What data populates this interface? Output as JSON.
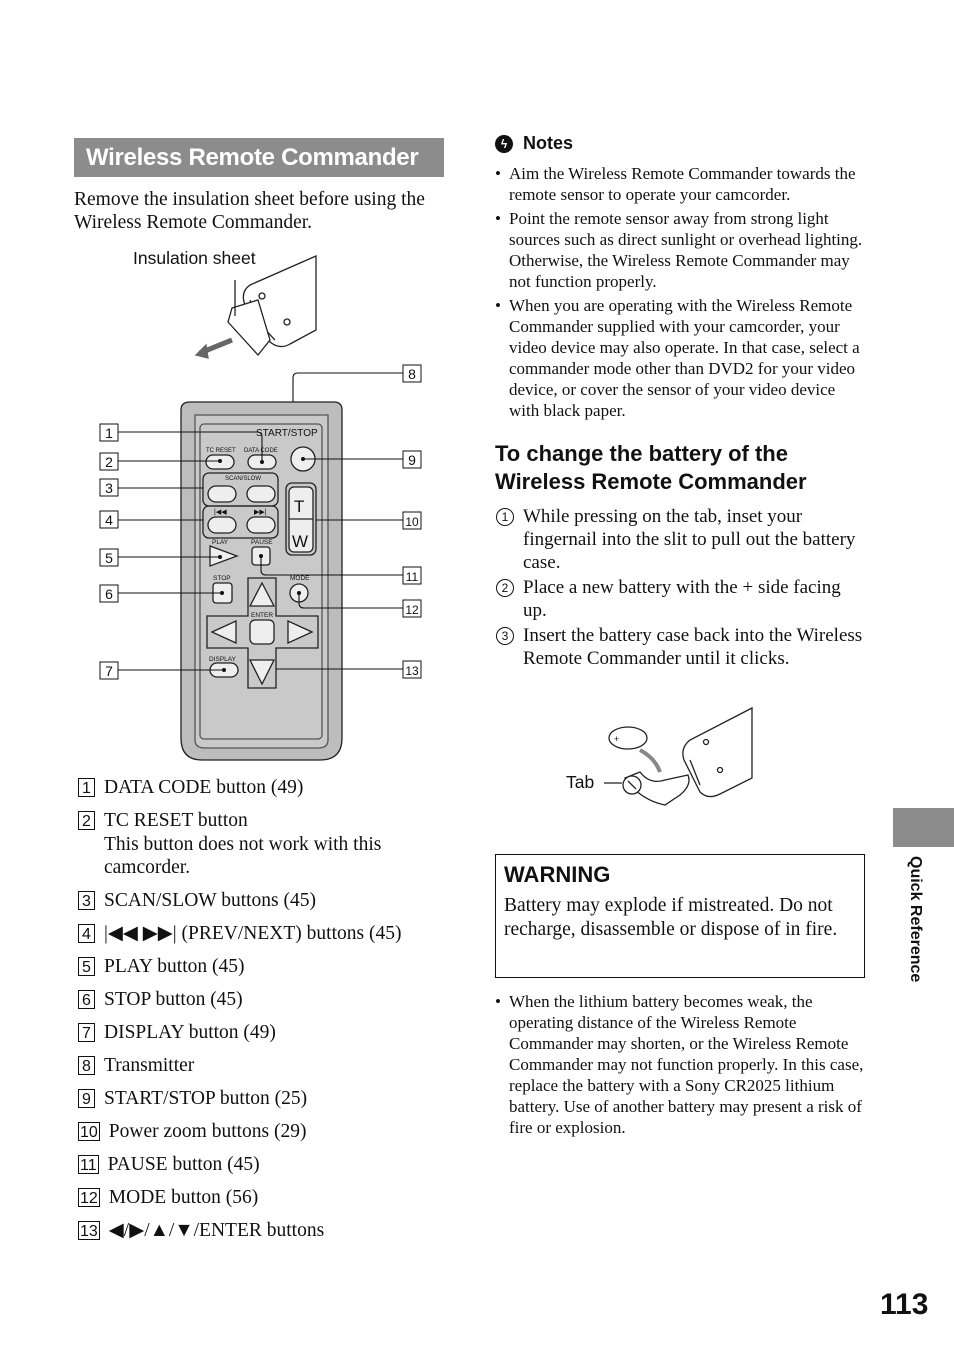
{
  "left": {
    "title": "Wireless Remote Commander",
    "intro": "Remove the insulation sheet before using the Wireless Remote Commander.",
    "figure": {
      "insulation_label": "Insulation sheet",
      "remote_labels": {
        "start_stop": "START/STOP",
        "tc_reset": "TC RESET",
        "data_code": "DATA CODE",
        "scan_slow": "SCAN/SLOW",
        "play": "PLAY",
        "pause": "PAUSE",
        "stop": "STOP",
        "mode": "MODE",
        "enter": "ENTER",
        "display": "DISPLAY",
        "t": "T",
        "w": "W"
      },
      "callouts": [
        "1",
        "2",
        "3",
        "4",
        "5",
        "6",
        "7",
        "8",
        "9",
        "10",
        "11",
        "12",
        "13"
      ]
    },
    "items": [
      {
        "num": "1",
        "text": "DATA CODE button (49)"
      },
      {
        "num": "2",
        "text": "TC RESET button",
        "sub": "This button does not work with this camcorder."
      },
      {
        "num": "3",
        "text": "SCAN/SLOW buttons (45)"
      },
      {
        "num": "4",
        "text": "|◀◀  ▶▶| (PREV/NEXT) buttons (45)"
      },
      {
        "num": "5",
        "text": "PLAY button (45)"
      },
      {
        "num": "6",
        "text": "STOP button (45)"
      },
      {
        "num": "7",
        "text": "DISPLAY button (49)"
      },
      {
        "num": "8",
        "text": "Transmitter"
      },
      {
        "num": "9",
        "text": "START/STOP button (25)"
      },
      {
        "num": "10",
        "text": "Power zoom buttons (29)"
      },
      {
        "num": "11",
        "text": "PAUSE button (45)"
      },
      {
        "num": "12",
        "text": "MODE button (56)"
      },
      {
        "num": "13",
        "text": "◀/▶/▲/▼/ENTER buttons"
      }
    ]
  },
  "right": {
    "notes_title": "Notes",
    "notes": [
      "Aim the Wireless Remote Commander towards the remote sensor to operate your camcorder.",
      "Point the remote sensor away from strong light sources such as direct sunlight or overhead lighting. Otherwise, the Wireless Remote Commander may not function properly.",
      "When you are operating with the Wireless Remote Commander supplied with your camcorder, your video device may also operate. In that case, select a commander mode other than DVD2 for your video device, or cover the sensor of your video device with black paper."
    ],
    "battery_heading": "To change the battery of the Wireless Remote Commander",
    "steps": [
      {
        "num": "1",
        "text": "While pressing on the tab, inset your fingernail into the slit to pull out the battery case."
      },
      {
        "num": "2",
        "text": "Place a new battery with the + side facing up."
      },
      {
        "num": "3",
        "text": "Insert the battery case back into the Wireless Remote Commander until it clicks."
      }
    ],
    "battery_figure": {
      "tab_label": "Tab",
      "battery_mark": "+"
    },
    "warning": {
      "title": "WARNING",
      "text": "Battery may explode if mistreated. Do not recharge, disassemble or dispose of in fire."
    },
    "after_note": "When the lithium battery becomes weak, the operating distance of the Wireless Remote Commander may shorten, or the Wireless Remote Commander may not function properly. In this case, replace the battery with a Sony CR2025 lithium battery. Use of another battery may present a risk of fire or explosion."
  },
  "side_tab": {
    "label": "Quick Reference",
    "color": "#8c8c8c"
  },
  "page_number": "113"
}
